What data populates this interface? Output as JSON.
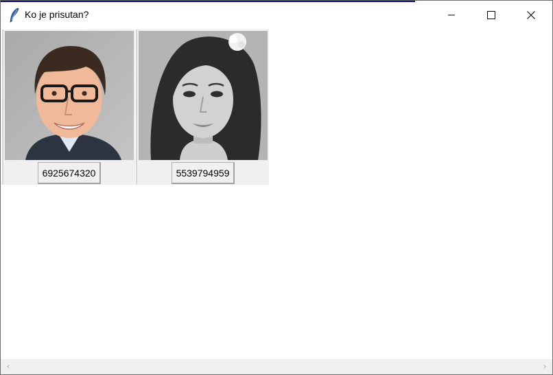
{
  "window": {
    "title": "Ko je prisutan?",
    "app_icon": "feather-icon",
    "controls": [
      "minimize-icon",
      "maximize-icon",
      "close-icon"
    ]
  },
  "cards": [
    {
      "photo": "photo-of-man-with-glasses",
      "button_label": "6925674320"
    },
    {
      "photo": "grayscale-photo-of-woman",
      "button_label": "5539794959"
    }
  ],
  "scrollbar": {
    "left_arrow": "‹",
    "right_arrow": "›"
  },
  "colors": {
    "accent_line": "#0a0a80",
    "card_bg": "#f0f0f0"
  }
}
